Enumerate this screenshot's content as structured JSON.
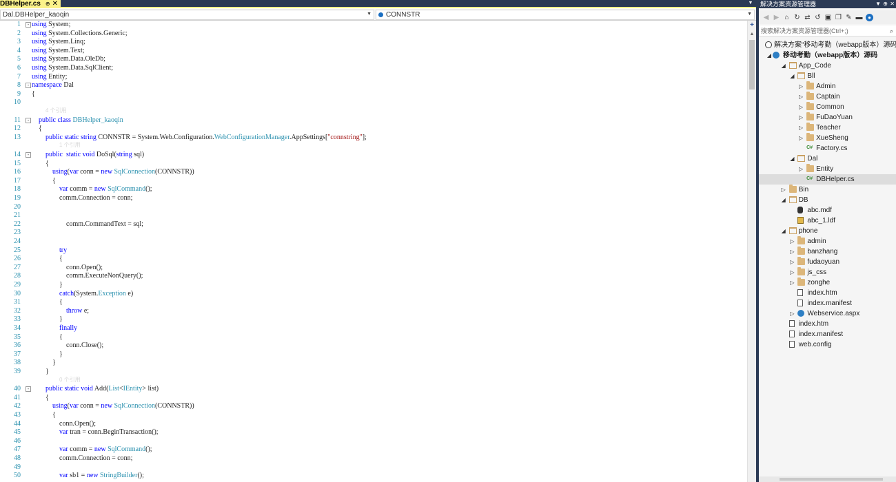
{
  "editor": {
    "tab": {
      "title": "DBHelper.cs",
      "pin": "⊕",
      "close": "✕"
    },
    "nav_class": "Dal.DBHelper_kaoqin",
    "nav_member": "CONNSTR",
    "lines": [
      {
        "n": "1",
        "fold": "-",
        "tokens": [
          [
            "kw",
            "using"
          ],
          [
            "",
            "System;"
          ]
        ]
      },
      {
        "n": "2",
        "fold": "",
        "tokens": [
          [
            "kw",
            "using"
          ],
          [
            "",
            "System.Collections.Generic;"
          ]
        ]
      },
      {
        "n": "3",
        "fold": "",
        "tokens": [
          [
            "kw",
            "using"
          ],
          [
            "",
            "System.Linq;"
          ]
        ]
      },
      {
        "n": "4",
        "fold": "",
        "tokens": [
          [
            "kw",
            "using"
          ],
          [
            "",
            "System.Text;"
          ]
        ]
      },
      {
        "n": "5",
        "fold": "",
        "tokens": [
          [
            "kw",
            "using"
          ],
          [
            "",
            "System.Data.OleDb;"
          ]
        ]
      },
      {
        "n": "6",
        "fold": "",
        "tokens": [
          [
            "kw",
            "using"
          ],
          [
            "",
            "System.Data.SqlClient;"
          ]
        ]
      },
      {
        "n": "7",
        "fold": "",
        "tokens": [
          [
            "kw",
            "using"
          ],
          [
            "",
            "Entity;"
          ]
        ]
      },
      {
        "n": "8",
        "fold": "-",
        "tokens": [
          [
            "kw",
            "namespace"
          ],
          [
            "",
            "Dal"
          ]
        ]
      },
      {
        "n": "9",
        "fold": "",
        "tokens": [
          [
            "",
            "{"
          ]
        ]
      },
      {
        "n": "10",
        "fold": "",
        "tokens": []
      },
      {
        "lens": "4 个引用",
        "indent": 1
      },
      {
        "n": "11",
        "fold": "-",
        "tokens": [
          [
            "",
            "    "
          ],
          [
            "kw",
            "public class"
          ],
          [
            "ty",
            "DBHelper_kaoqin"
          ]
        ]
      },
      {
        "n": "12",
        "fold": "",
        "tokens": [
          [
            "",
            "    {"
          ]
        ]
      },
      {
        "n": "13",
        "fold": "",
        "tokens": [
          [
            "",
            "        "
          ],
          [
            "kw",
            "public static string"
          ],
          [
            "",
            "CONNSTR = System.Web.Configuration."
          ],
          [
            "ty",
            "WebConfigurationManager"
          ],
          [
            "",
            ".AppSettings["
          ],
          [
            "st",
            "\"connstring\""
          ],
          [
            "",
            "];"
          ]
        ]
      },
      {
        "lens": "1 个引用",
        "indent": 2
      },
      {
        "n": "14",
        "fold": "-",
        "tokens": [
          [
            "",
            "        "
          ],
          [
            "kw",
            "public  static void"
          ],
          [
            "",
            "DoSql("
          ],
          [
            "kw",
            "string"
          ],
          [
            "",
            "sql)"
          ]
        ]
      },
      {
        "n": "15",
        "fold": "",
        "tokens": [
          [
            "",
            "        {"
          ]
        ]
      },
      {
        "n": "16",
        "fold": "",
        "tokens": [
          [
            "",
            "            "
          ],
          [
            "kw",
            "using"
          ],
          [
            "",
            "("
          ],
          [
            "kw",
            "var"
          ],
          [
            "",
            "conn = "
          ],
          [
            "kw",
            "new"
          ],
          [
            "ty",
            "SqlConnection"
          ],
          [
            "",
            "(CONNSTR))"
          ]
        ]
      },
      {
        "n": "17",
        "fold": "",
        "tokens": [
          [
            "",
            "            {"
          ]
        ]
      },
      {
        "n": "18",
        "fold": "",
        "tokens": [
          [
            "",
            "                "
          ],
          [
            "kw",
            "var"
          ],
          [
            "",
            "comm = "
          ],
          [
            "kw",
            "new"
          ],
          [
            "ty",
            "SqlCommand"
          ],
          [
            "",
            "();"
          ]
        ]
      },
      {
        "n": "19",
        "fold": "",
        "tokens": [
          [
            "",
            "                comm.Connection = conn;"
          ]
        ]
      },
      {
        "n": "20",
        "fold": "",
        "tokens": []
      },
      {
        "n": "21",
        "fold": "",
        "tokens": []
      },
      {
        "n": "22",
        "fold": "",
        "tokens": [
          [
            "",
            "                    comm.CommandText = sql;"
          ]
        ]
      },
      {
        "n": "23",
        "fold": "",
        "tokens": []
      },
      {
        "n": "24",
        "fold": "",
        "tokens": []
      },
      {
        "n": "25",
        "fold": "",
        "tokens": [
          [
            "",
            "                "
          ],
          [
            "kw",
            "try"
          ]
        ]
      },
      {
        "n": "26",
        "fold": "",
        "tokens": [
          [
            "",
            "                {"
          ]
        ]
      },
      {
        "n": "27",
        "fold": "",
        "tokens": [
          [
            "",
            "                    conn.Open();"
          ]
        ]
      },
      {
        "n": "28",
        "fold": "",
        "tokens": [
          [
            "",
            "                    comm.ExecuteNonQuery();"
          ]
        ]
      },
      {
        "n": "29",
        "fold": "",
        "tokens": [
          [
            "",
            "                }"
          ]
        ]
      },
      {
        "n": "30",
        "fold": "",
        "tokens": [
          [
            "",
            "                "
          ],
          [
            "kw",
            "catch"
          ],
          [
            "",
            "(System."
          ],
          [
            "ty",
            "Exception"
          ],
          [
            "",
            "e)"
          ]
        ]
      },
      {
        "n": "31",
        "fold": "",
        "tokens": [
          [
            "",
            "                {"
          ]
        ]
      },
      {
        "n": "32",
        "fold": "",
        "tokens": [
          [
            "",
            "                    "
          ],
          [
            "kw",
            "throw"
          ],
          [
            "",
            "e;"
          ]
        ]
      },
      {
        "n": "33",
        "fold": "",
        "tokens": [
          [
            "",
            "                }"
          ]
        ]
      },
      {
        "n": "34",
        "fold": "",
        "tokens": [
          [
            "",
            "                "
          ],
          [
            "kw",
            "finally"
          ]
        ]
      },
      {
        "n": "35",
        "fold": "",
        "tokens": [
          [
            "",
            "                {"
          ]
        ]
      },
      {
        "n": "36",
        "fold": "",
        "tokens": [
          [
            "",
            "                    conn.Close();"
          ]
        ]
      },
      {
        "n": "37",
        "fold": "",
        "tokens": [
          [
            "",
            "                }"
          ]
        ]
      },
      {
        "n": "38",
        "fold": "",
        "tokens": [
          [
            "",
            "            }"
          ]
        ]
      },
      {
        "n": "39",
        "fold": "",
        "tokens": [
          [
            "",
            "        }"
          ]
        ]
      },
      {
        "lens": "0 个引用",
        "indent": 2
      },
      {
        "n": "40",
        "fold": "-",
        "tokens": [
          [
            "",
            "        "
          ],
          [
            "kw",
            "public static void"
          ],
          [
            "",
            "Add("
          ],
          [
            "ty",
            "List"
          ],
          [
            "",
            "<"
          ],
          [
            "ty",
            "IEntity"
          ],
          [
            "",
            "> list)"
          ]
        ]
      },
      {
        "n": "41",
        "fold": "",
        "tokens": [
          [
            "",
            "        {"
          ]
        ]
      },
      {
        "n": "42",
        "fold": "",
        "tokens": [
          [
            "",
            "            "
          ],
          [
            "kw",
            "using"
          ],
          [
            "",
            "("
          ],
          [
            "kw",
            "var"
          ],
          [
            "",
            "conn = "
          ],
          [
            "kw",
            "new"
          ],
          [
            "ty",
            "SqlConnection"
          ],
          [
            "",
            "(CONNSTR))"
          ]
        ]
      },
      {
        "n": "43",
        "fold": "",
        "tokens": [
          [
            "",
            "            {"
          ]
        ]
      },
      {
        "n": "44",
        "fold": "",
        "tokens": [
          [
            "",
            "                conn.Open();"
          ]
        ]
      },
      {
        "n": "45",
        "fold": "",
        "tokens": [
          [
            "",
            "                "
          ],
          [
            "kw",
            "var"
          ],
          [
            "",
            "tran = conn.BeginTransaction();"
          ]
        ]
      },
      {
        "n": "46",
        "fold": "",
        "tokens": []
      },
      {
        "n": "47",
        "fold": "",
        "tokens": [
          [
            "",
            "                "
          ],
          [
            "kw",
            "var"
          ],
          [
            "",
            "comm = "
          ],
          [
            "kw",
            "new"
          ],
          [
            "ty",
            "SqlCommand"
          ],
          [
            "",
            "();"
          ]
        ]
      },
      {
        "n": "48",
        "fold": "",
        "tokens": [
          [
            "",
            "                comm.Connection = conn;"
          ]
        ]
      },
      {
        "n": "49",
        "fold": "",
        "tokens": []
      },
      {
        "n": "50",
        "fold": "",
        "tokens": [
          [
            "",
            "                "
          ],
          [
            "kw",
            "var"
          ],
          [
            "",
            "sb1 = "
          ],
          [
            "kw",
            "new"
          ],
          [
            "ty",
            "StringBuilder"
          ],
          [
            "",
            "();"
          ]
        ]
      }
    ]
  },
  "solution_explorer": {
    "title": "解决方案资源管理器",
    "search_placeholder": "搜索解决方案资源管理器(Ctrl+;)",
    "nodes": [
      {
        "label": "解决方案“移动考勤（webapp版本）源码”(1",
        "level": 0,
        "twisty": "",
        "icon": "sln",
        "bold": false
      },
      {
        "label": "移动考勤（webapp版本）源码",
        "level": 0,
        "twisty": "◢",
        "icon": "web",
        "bold": true
      },
      {
        "label": "App_Code",
        "level": 1,
        "twisty": "◢",
        "icon": "folder-open"
      },
      {
        "label": "Bll",
        "level": 2,
        "twisty": "◢",
        "icon": "folder-open"
      },
      {
        "label": "Admin",
        "level": 3,
        "twisty": "▷",
        "icon": "folder"
      },
      {
        "label": "Captain",
        "level": 3,
        "twisty": "▷",
        "icon": "folder"
      },
      {
        "label": "Common",
        "level": 3,
        "twisty": "▷",
        "icon": "folder"
      },
      {
        "label": "FuDaoYuan",
        "level": 3,
        "twisty": "▷",
        "icon": "folder"
      },
      {
        "label": "Teacher",
        "level": 3,
        "twisty": "▷",
        "icon": "folder"
      },
      {
        "label": "XueSheng",
        "level": 3,
        "twisty": "▷",
        "icon": "folder"
      },
      {
        "label": "Factory.cs",
        "level": 3,
        "twisty": "",
        "icon": "cs"
      },
      {
        "label": "Dal",
        "level": 2,
        "twisty": "◢",
        "icon": "folder-open"
      },
      {
        "label": "Entity",
        "level": 3,
        "twisty": "▷",
        "icon": "folder"
      },
      {
        "label": "DBHelper.cs",
        "level": 3,
        "twisty": "",
        "icon": "cs",
        "selected": true
      },
      {
        "label": "Bin",
        "level": 1,
        "twisty": "▷",
        "icon": "folder"
      },
      {
        "label": "DB",
        "level": 1,
        "twisty": "◢",
        "icon": "folder-open"
      },
      {
        "label": "abc.mdf",
        "level": 2,
        "twisty": "",
        "icon": "db"
      },
      {
        "label": "abc_1.ldf",
        "level": 2,
        "twisty": "",
        "icon": "log"
      },
      {
        "label": "phone",
        "level": 1,
        "twisty": "◢",
        "icon": "folder-open"
      },
      {
        "label": "admin",
        "level": 2,
        "twisty": "▷",
        "icon": "folder"
      },
      {
        "label": "banzhang",
        "level": 2,
        "twisty": "▷",
        "icon": "folder"
      },
      {
        "label": "fudaoyuan",
        "level": 2,
        "twisty": "▷",
        "icon": "folder"
      },
      {
        "label": "js_css",
        "level": 2,
        "twisty": "▷",
        "icon": "folder"
      },
      {
        "label": "zonghe",
        "level": 2,
        "twisty": "▷",
        "icon": "folder"
      },
      {
        "label": "index.htm",
        "level": 2,
        "twisty": "",
        "icon": "file"
      },
      {
        "label": "index.manifest",
        "level": 2,
        "twisty": "",
        "icon": "file"
      },
      {
        "label": "Webservice.aspx",
        "level": 2,
        "twisty": "▷",
        "icon": "web"
      },
      {
        "label": "index.htm",
        "level": 1,
        "twisty": "",
        "icon": "file"
      },
      {
        "label": "index.manifest",
        "level": 1,
        "twisty": "",
        "icon": "file"
      },
      {
        "label": "web.config",
        "level": 1,
        "twisty": "",
        "icon": "config"
      }
    ]
  },
  "colors": {
    "keyword": "#0000ff",
    "type": "#2b91af",
    "string": "#a31515",
    "line_number": "#2b91af",
    "title_bar": "#2b3a55",
    "active_tab": "#fbf28a"
  }
}
